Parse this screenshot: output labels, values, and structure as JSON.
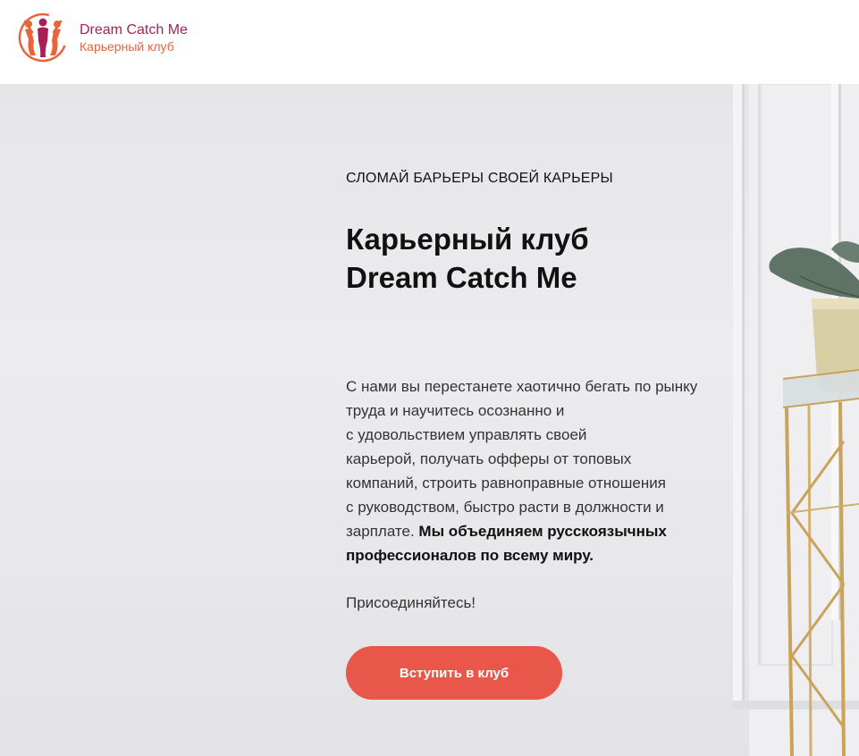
{
  "brand": {
    "name": "Dream Catch Me",
    "tagline": "Карьерный клуб",
    "colors": {
      "primary": "#a81f55",
      "accent": "#e8643a",
      "cta": "#e9564a"
    }
  },
  "hero": {
    "eyebrow": "СЛОМАЙ БАРЬЕРЫ СВОЕЙ КАРЬЕРЫ",
    "title_line1": "Карьерный клуб",
    "title_line2": "Dream Catch Me",
    "description_lines": [
      "С нами вы перестанете хаотично бегать по рынку",
      "труда и научитесь осознанно и",
      "с удовольствием управлять своей",
      "карьерой, получать офферы от топовых",
      "компаний, строить равноправные отношения",
      "с руководством, быстро расти в должности и"
    ],
    "description_tail_plain": "зарплате. ",
    "description_tail_bold": "Мы объединяем русскоязычных",
    "description_last_bold": "профессионалов по всему миру.",
    "join_text": "Присоединяйтесь!",
    "cta_label": "Вступить в клуб"
  }
}
